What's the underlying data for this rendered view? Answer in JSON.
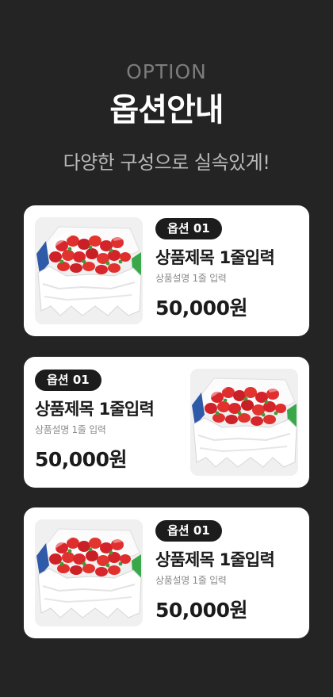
{
  "header": {
    "eyebrow": "OPTION",
    "title": "옵션안내",
    "subtitle": "다양한 구성으로 실속있게!"
  },
  "colors": {
    "background": "#242424",
    "card": "#ffffff",
    "badge": "#1c1c1c"
  },
  "options": [
    {
      "badge": "옵션 01",
      "title": "상품제목 1줄입력",
      "description": "상품설명 1줄 입력",
      "price": "50,000원",
      "image": "strawberry-box-image",
      "image_side": "left"
    },
    {
      "badge": "옵션 01",
      "title": "상품제목 1줄입력",
      "description": "상품설명 1줄 입력",
      "price": "50,000원",
      "image": "strawberry-box-image",
      "image_side": "right"
    },
    {
      "badge": "옵션 01",
      "title": "상품제목 1줄입력",
      "description": "상품설명 1줄 입력",
      "price": "50,000원",
      "image": "strawberry-box-image",
      "image_side": "left"
    }
  ]
}
